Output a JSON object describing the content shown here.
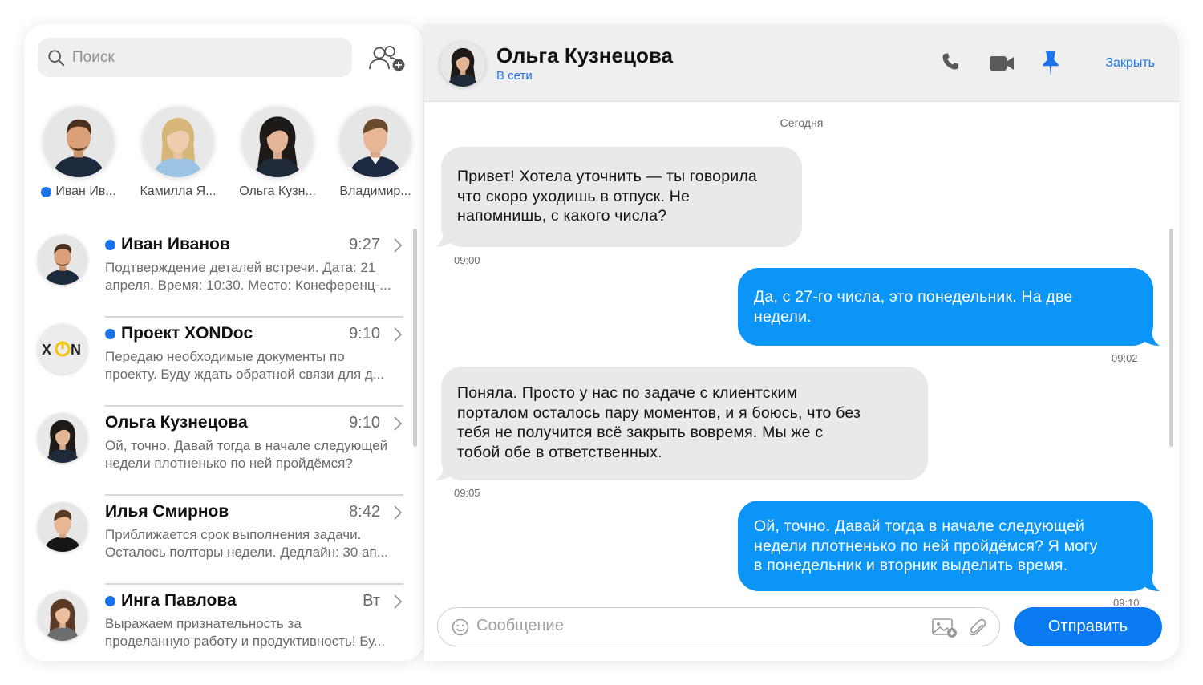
{
  "search": {
    "placeholder": "Поиск"
  },
  "stories": [
    {
      "name": "Иван Ив...",
      "online": true
    },
    {
      "name": "Камилла Я...",
      "online": false
    },
    {
      "name": "Ольга Кузн...",
      "online": false
    },
    {
      "name": "Владимир...",
      "online": false
    }
  ],
  "chats": [
    {
      "title": "Иван Иванов",
      "time": "9:27",
      "unread": true,
      "preview1": "Подтверждение деталей встречи. Дата: 21",
      "preview2": "апреля. Время: 10:30. Место: Конеференц-..."
    },
    {
      "title": "Проект XONDoc",
      "time": "9:10",
      "unread": true,
      "preview1": "Передаю необходимые документы по",
      "preview2": "проекту. Буду ждать обратной связи для д...",
      "logo_text": "XON"
    },
    {
      "title": "Ольга Кузнецова",
      "time": "9:10",
      "unread": false,
      "preview1": "Ой, точно. Давай тогда в начале следующей",
      "preview2": "недели плотненько по ней пройдёмся?"
    },
    {
      "title": "Илья Смирнов",
      "time": "8:42",
      "unread": false,
      "preview1": "Приближается срок выполнения задачи.",
      "preview2": "Осталось полторы недели. Дедлайн: 30 ап..."
    },
    {
      "title": "Инга Павлова",
      "time": "Вт",
      "unread": true,
      "preview1": "Выражаем признательность за",
      "preview2": "проделанную работу и продуктивность! Бу..."
    }
  ],
  "header": {
    "name": "Ольга Кузнецова",
    "status": "В сети",
    "close_label": "Закрыть"
  },
  "day_label": "Сегодня",
  "messages": [
    {
      "dir": "in",
      "time": "09:00",
      "lines": [
        "Привет! Хотела уточнить — ты говорила",
        "что скоро уходишь в отпуск. Не",
        "напомнишь, с какого числа?"
      ]
    },
    {
      "dir": "out",
      "time": "09:02",
      "lines": [
        "Да, с 27-го числа, это понедельник. На две",
        "недели."
      ]
    },
    {
      "dir": "in",
      "time": "09:05",
      "lines": [
        "Поняла. Просто у нас по задаче с клиентским",
        "порталом осталось пару моментов, и я боюсь, что без",
        "тебя не получится всё закрыть вовремя. Мы же с",
        "тобой обе в ответственных."
      ]
    },
    {
      "dir": "out",
      "time": "09:10",
      "lines": [
        "Ой, точно. Давай тогда в начале следующей",
        "недели плотненько по ней пройдёмся? Я могу",
        "в понедельник и вторник выделить время."
      ]
    }
  ],
  "composer": {
    "placeholder": "Сообщение",
    "send_label": "Отправить"
  },
  "colors": {
    "accent": "#1a73e8",
    "outgoing_bubble": "#0a95f7",
    "incoming_bubble": "#e9e9eb",
    "send_button": "#0a7af0"
  }
}
